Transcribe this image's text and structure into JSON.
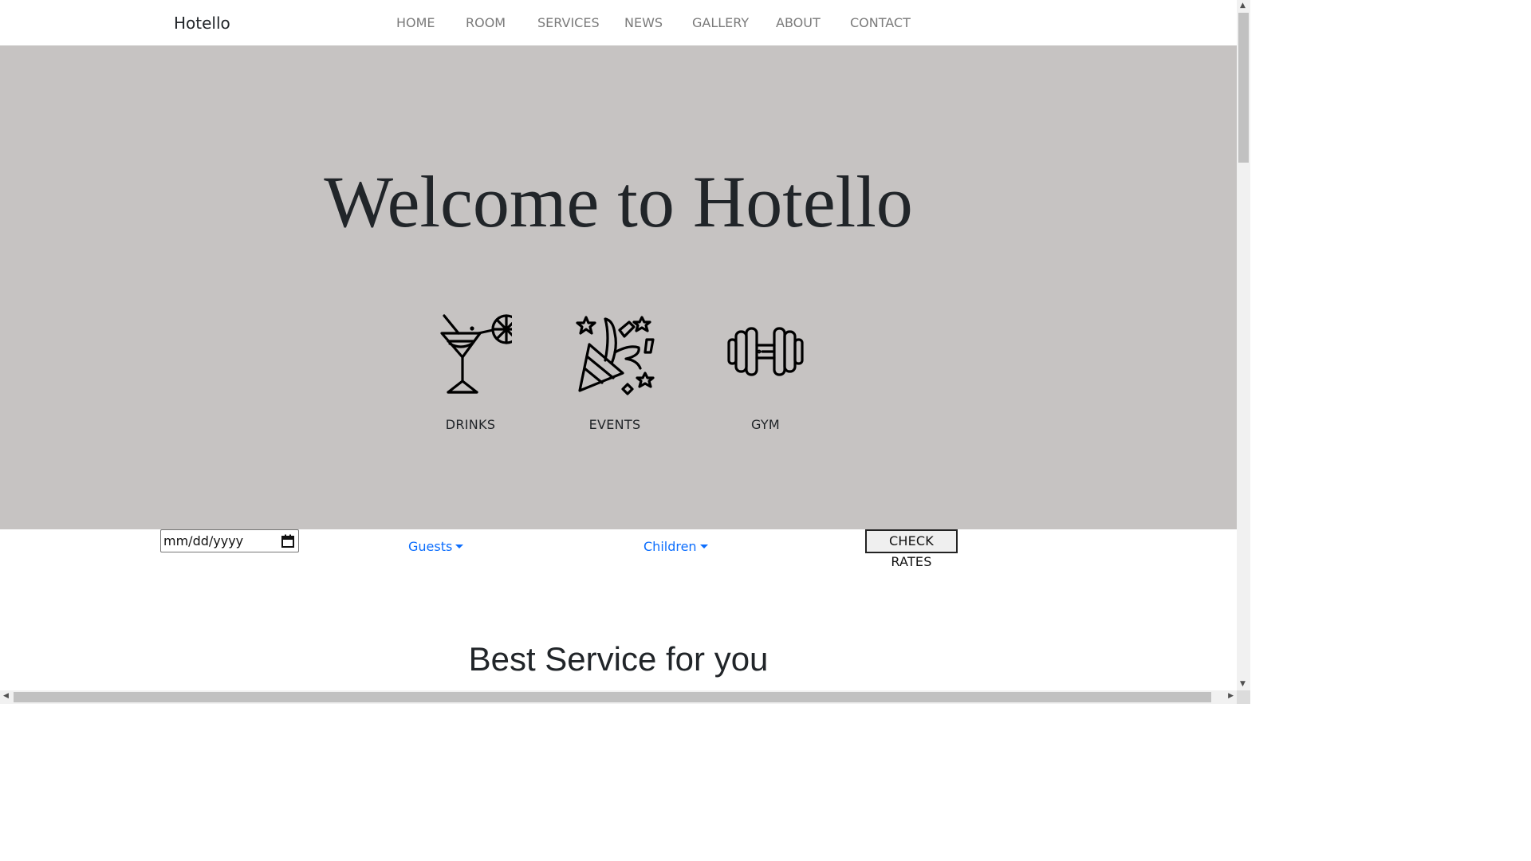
{
  "navbar": {
    "brand": "Hotello",
    "items": [
      {
        "label": "HOME"
      },
      {
        "label": "ROOM"
      },
      {
        "label": "SERVICES"
      },
      {
        "label": "NEWS"
      },
      {
        "label": "GALLERY"
      },
      {
        "label": "ABOUT"
      },
      {
        "label": "CONTACT"
      }
    ]
  },
  "hero": {
    "title": "Welcome to Hotello",
    "features": [
      {
        "label": "DRINKS",
        "icon": "cocktail-icon"
      },
      {
        "label": "EVENTS",
        "icon": "party-popper-icon"
      },
      {
        "label": "GYM",
        "icon": "dumbbell-icon"
      }
    ],
    "background_color": "#c6c3c2"
  },
  "booking": {
    "date_placeholder": "mm/dd/yyyy",
    "guests_label": "Guests",
    "children_label": "Children",
    "check_rates_label": "CHECK RATES",
    "link_color": "#0d6efd"
  },
  "section": {
    "title": "Best Service for you"
  }
}
